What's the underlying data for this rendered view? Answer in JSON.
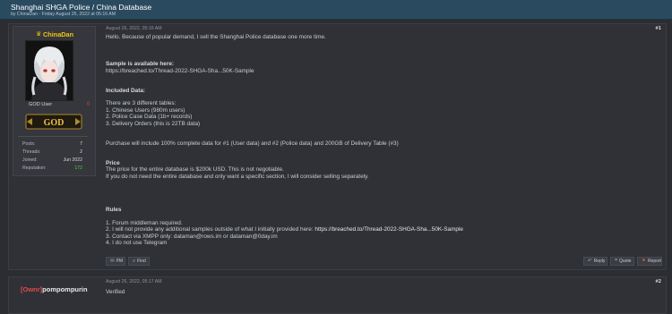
{
  "thread": {
    "title": "Shanghai SHGA Police / China Database",
    "byline": "by ChinaDan - Friday August 26, 2022 at 05:16 AM"
  },
  "post1": {
    "date": "August 26, 2022, 05:16 AM",
    "number": "#1",
    "author": {
      "name": "ChinaDan",
      "crown": "♛",
      "title": "GOD User",
      "badge": "GOD",
      "rep_indicator": "0",
      "stats": [
        {
          "label": "Posts:",
          "value": "7"
        },
        {
          "label": "Threads:",
          "value": "2"
        },
        {
          "label": "Joined:",
          "value": "Jun 2022"
        },
        {
          "label": "Reputation:",
          "value": "172"
        }
      ]
    },
    "lines": [
      "Hello. Because of popular demand, I sell the Shanghai Police database one more time.",
      "Sample is available here:",
      "https://breached.to/Thread-2022-SHGA-Sha...50K-Sample",
      "Included Data:",
      "There are 3 different tables:",
      "1. Chinese Users  (980m users)",
      "2. Police Case Data (1b+ records)",
      "3. Delivery Orders (this is 22TB data)",
      "Purchase will include 100% complete data for #1 (User data) and #2 (Police data) and 200GB of Delivery Table (#3)",
      "Price",
      "The price for the entire database is $200k USD. This is not negotiable.",
      "If you do not need the entire database and only want a specific section, I will consider selling separately.",
      "Rules",
      "1. Forum middleman required.",
      "2. I will not provide any additional samples outside of what I initially provided here: ",
      "https://breached.to/Thread-2022-SHGA-Sha...50K-Sample",
      "3. Contact via XMPP only: dataman@rows.im or dataman@0day.im",
      "4. I do not use Telegram"
    ],
    "buttons": {
      "pm": "PM",
      "find": "Find",
      "reply": "Reply",
      "quote": "Quote",
      "report": "Report"
    }
  },
  "post2": {
    "date": "August 26, 2022, 05:17 AM",
    "number": "#2",
    "author_tag": "[Ownr]",
    "author_name": "pompompurin",
    "text": "Verified"
  },
  "colors": {
    "header_bg": "#2a4a5f",
    "page_bg": "#2b2d31",
    "username": "#f2c40f",
    "reputation": "#4bd14b"
  }
}
